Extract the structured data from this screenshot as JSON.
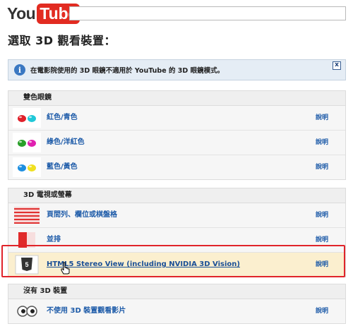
{
  "header": {
    "logo_you": "You",
    "logo_tube": "Tube",
    "search_value": ""
  },
  "page_title": "選取 3D 觀看裝置：",
  "notice": {
    "text": "在電影院使用的 3D 眼鏡不適用於 YouTube 的 3D 眼鏡模式。",
    "close_label": "x"
  },
  "sections": [
    {
      "heading": "雙色眼鏡",
      "items": [
        {
          "label": "紅色/青色",
          "help": "說明",
          "icon": "red-cyan-glasses-icon",
          "colors": [
            "#e0202a",
            "#20c8d8"
          ]
        },
        {
          "label": "綠色/洋紅色",
          "help": "說明",
          "icon": "green-magenta-glasses-icon",
          "colors": [
            "#2aa02a",
            "#e020b0"
          ]
        },
        {
          "label": "藍色/黃色",
          "help": "說明",
          "icon": "blue-yellow-glasses-icon",
          "colors": [
            "#1e8fe0",
            "#f0e020"
          ]
        }
      ]
    },
    {
      "heading": "3D 電視或螢幕",
      "items": [
        {
          "label": "頁間列、欄位或棋盤格",
          "help": "說明",
          "icon": "interlaced-stripes-icon"
        },
        {
          "label": "並排",
          "help": "說明",
          "icon": "side-by-side-icon"
        },
        {
          "label": "HTML5 Stereo View (including NVIDIA 3D Vision)",
          "help": "說明",
          "icon": "html5-icon"
        }
      ]
    },
    {
      "heading": "沒有 3D 裝置",
      "items": [
        {
          "label": "不使用 3D 裝置觀看影片",
          "help": "說明",
          "icon": "eyes-icon"
        }
      ]
    }
  ],
  "colors": {
    "accent_link": "#1c5aa8",
    "highlight_border": "#e0242a",
    "selected_row_bg": "#fbefcf"
  }
}
